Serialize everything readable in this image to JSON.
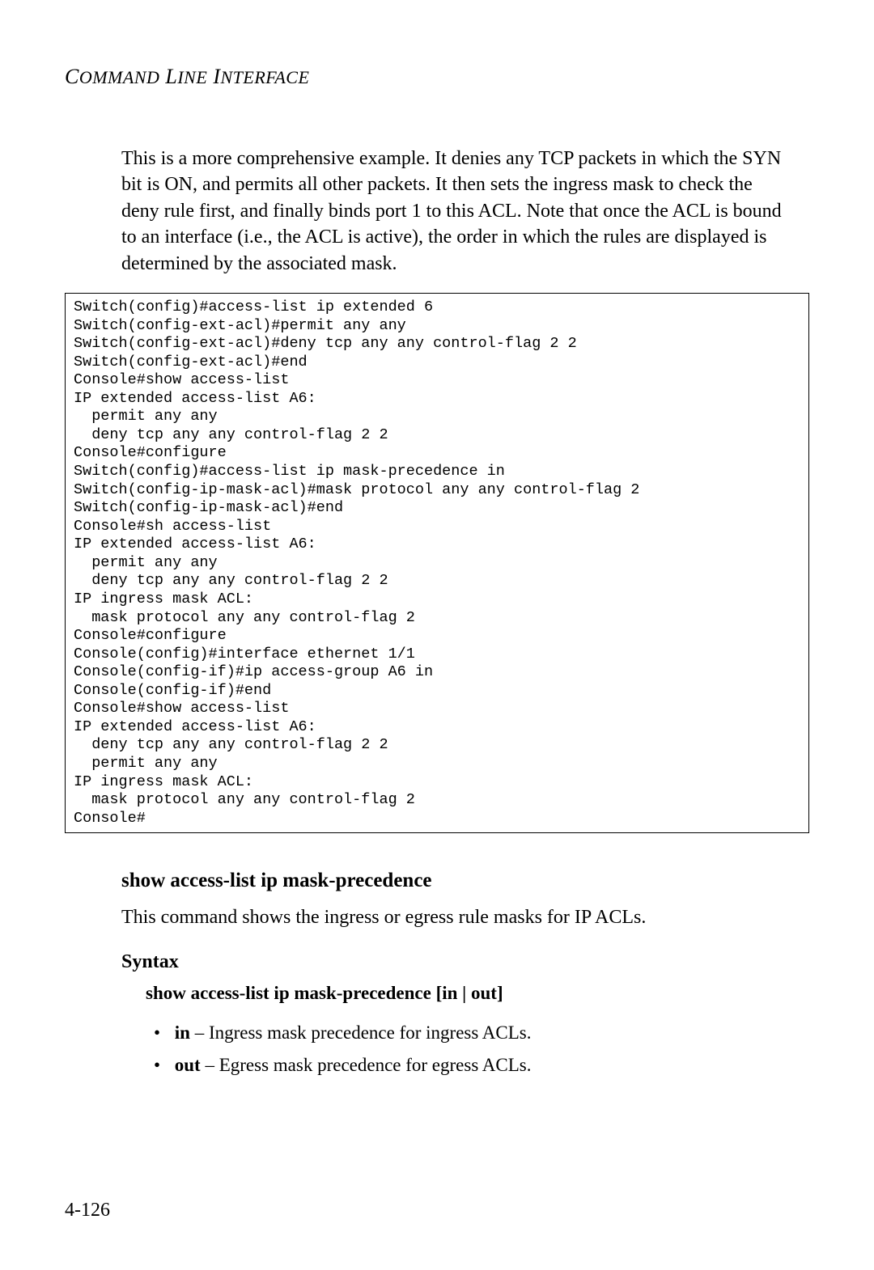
{
  "header": {
    "title_html": "C<span style=\"font-size:22px;\">OMMAND</span> L<span style=\"font-size:22px;\">INE</span> I<span style=\"font-size:22px;\">NTERFACE</span>"
  },
  "intro_paragraph": "This is a more comprehensive example. It denies any TCP packets in which the SYN bit is ON, and permits all other packets. It then sets the ingress mask to check the deny rule first, and finally binds port 1 to this ACL. Note that once the ACL is bound to an interface (i.e., the ACL is active), the order in which the rules are displayed is determined by the associated mask.",
  "code_block": "Switch(config)#access-list ip extended 6\nSwitch(config-ext-acl)#permit any any\nSwitch(config-ext-acl)#deny tcp any any control-flag 2 2\nSwitch(config-ext-acl)#end\nConsole#show access-list\nIP extended access-list A6:\n  permit any any\n  deny tcp any any control-flag 2 2\nConsole#configure\nSwitch(config)#access-list ip mask-precedence in\nSwitch(config-ip-mask-acl)#mask protocol any any control-flag 2\nSwitch(config-ip-mask-acl)#end\nConsole#sh access-list\nIP extended access-list A6:\n  permit any any\n  deny tcp any any control-flag 2 2\nIP ingress mask ACL:\n  mask protocol any any control-flag 2\nConsole#configure\nConsole(config)#interface ethernet 1/1\nConsole(config-if)#ip access-group A6 in\nConsole(config-if)#end\nConsole#show access-list\nIP extended access-list A6:\n  deny tcp any any control-flag 2 2\n  permit any any\nIP ingress mask ACL:\n  mask protocol any any control-flag 2\nConsole#",
  "section": {
    "heading": "show access-list ip mask-precedence",
    "description": "This command shows the ingress or egress rule masks for IP ACLs.",
    "syntax_label": "Syntax",
    "syntax_line_prefix": "show access-list ip mask-precedence",
    "syntax_line_options": "[in | out]",
    "bullets": [
      {
        "keyword": "in",
        "desc": " – Ingress mask precedence for ingress ACLs."
      },
      {
        "keyword": "out",
        "desc": " – Egress mask precedence for egress ACLs."
      }
    ]
  },
  "page_number": "4-126"
}
